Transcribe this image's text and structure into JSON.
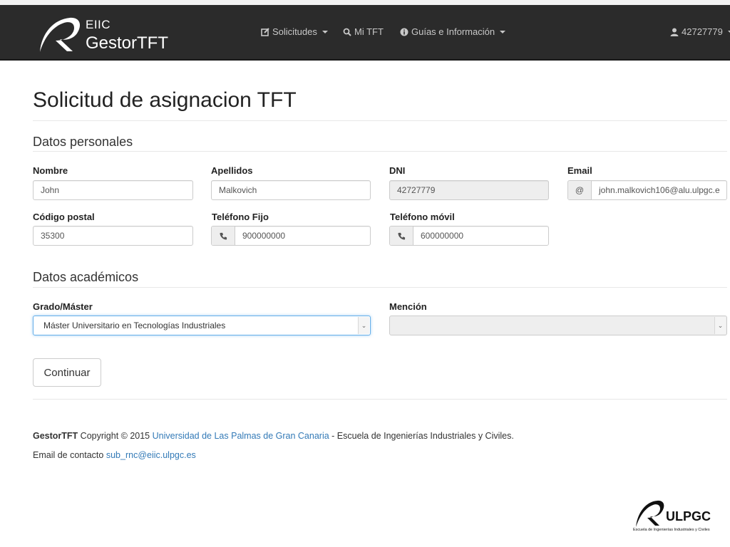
{
  "colors": {
    "navbar": "#2b2b2b",
    "link": "#337ab7",
    "focus_border": "#66afe9"
  },
  "brand": {
    "line1": "EIIC",
    "line2": "GestorTFT"
  },
  "nav": {
    "solicitudes": {
      "label": "Solicitudes",
      "icon": "edit-icon"
    },
    "mi_tft": {
      "label": "Mi TFT",
      "icon": "search-icon"
    },
    "guias": {
      "label": "Guías e Información",
      "icon": "info-icon"
    },
    "user": {
      "label": "42727779",
      "icon": "user-icon"
    }
  },
  "page": {
    "title": "Solicitud de asignacion TFT"
  },
  "personal": {
    "heading": "Datos personales",
    "nombre": {
      "label": "Nombre",
      "value": "John"
    },
    "apellidos": {
      "label": "Apellidos",
      "value": "Malkovich"
    },
    "dni": {
      "label": "DNI",
      "value": "42727779"
    },
    "email": {
      "label": "Email",
      "addon": "@",
      "value": "john.malkovich106@alu.ulpgc.e"
    },
    "codigo_postal": {
      "label": "Código postal",
      "value": "35300"
    },
    "telefono_fijo": {
      "label": "Teléfono Fijo",
      "value": "900000000",
      "icon": "phone-icon"
    },
    "telefono_movil": {
      "label": "Teléfono móvil",
      "value": "600000000",
      "icon": "phone-icon"
    }
  },
  "academic": {
    "heading": "Datos académicos",
    "grado": {
      "label": "Grado/Máster",
      "selected": "Máster Universitario en Tecnologías Industriales"
    },
    "mencion": {
      "label": "Mención",
      "selected": ""
    }
  },
  "actions": {
    "continue_label": "Continuar"
  },
  "footer": {
    "brand": "GestorTFT",
    "copyright": " Copyright © 2015 ",
    "university": "Universidad de Las Palmas de Gran Canaria",
    "rest": " - Escuela de Ingenierías Industriales y Civiles.",
    "contact_label": "Email de contacto ",
    "contact_email": "sub_rnc@eiic.ulpgc.es"
  },
  "logo_ulpgc": {
    "name": "ULPGC",
    "caption": "Escuela de Ingenierías Industriales y Civiles"
  }
}
